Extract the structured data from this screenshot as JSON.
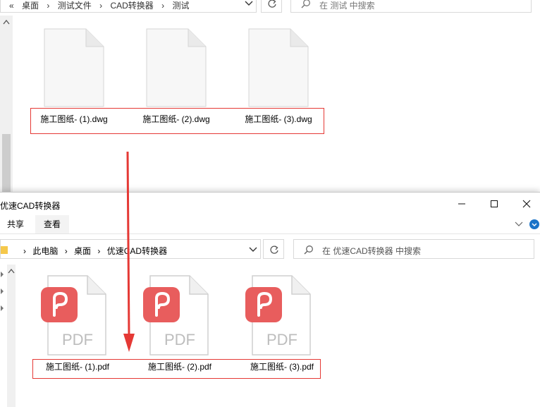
{
  "top_window": {
    "breadcrumb": [
      "«",
      "桌面",
      "›",
      "测试文件",
      "›",
      "CAD转换器",
      "›",
      "测试"
    ],
    "search_placeholder": "在 测试 中搜索",
    "files": [
      {
        "name": "施工图纸- (1).dwg"
      },
      {
        "name": "施工图纸- (2).dwg"
      },
      {
        "name": "施工图纸- (3).dwg"
      }
    ]
  },
  "bottom_window": {
    "title": "优速CAD转换器",
    "ribbon_tabs": [
      "共享",
      "查看"
    ],
    "breadcrumb": [
      "›",
      "此电脑",
      "›",
      "桌面",
      "›",
      "优速CAD转换器"
    ],
    "search_placeholder": "在 优速CAD转换器 中搜索",
    "pdf_badge": "PDF",
    "files": [
      {
        "name": "施工图纸- (1).pdf"
      },
      {
        "name": "施工图纸- (2).pdf"
      },
      {
        "name": "施工图纸- (3).pdf"
      }
    ]
  },
  "colors": {
    "highlight_box": "#e53935",
    "arrow": "#e53935",
    "pdf_logo": "#e85d5d"
  },
  "icons": [
    "search-icon",
    "refresh-icon",
    "chevron-down-icon",
    "folder-icon",
    "minimize-icon",
    "maximize-icon",
    "close-icon",
    "help-icon",
    "document-icon",
    "pdf-file-icon",
    "down-arrow-icon"
  ]
}
